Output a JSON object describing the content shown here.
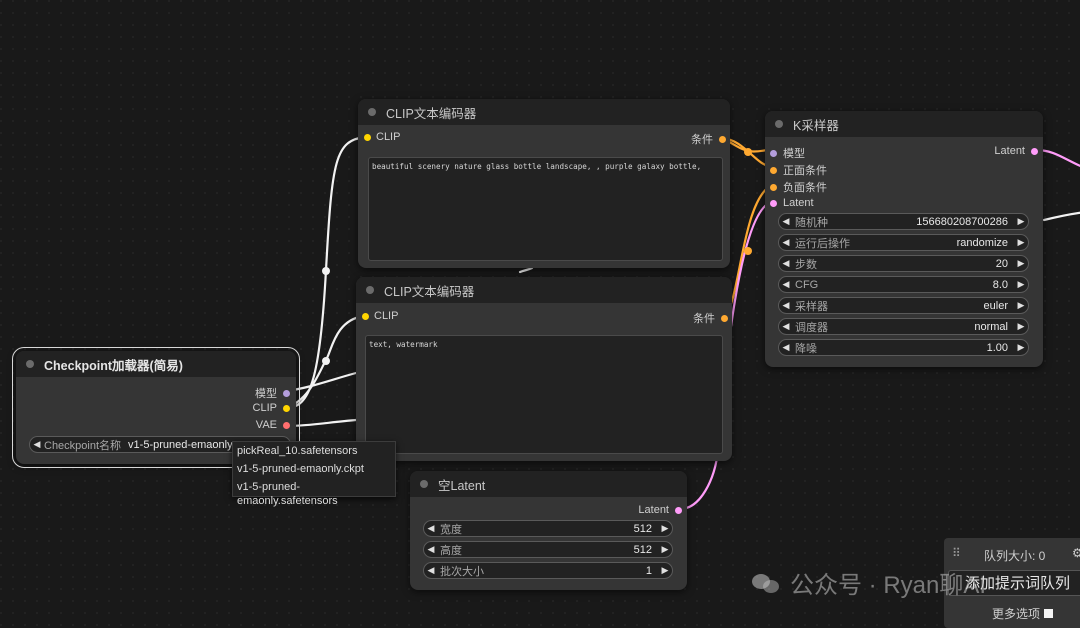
{
  "colors": {
    "clip": "#ffd500",
    "conditioning": "#ffa931",
    "model": "#b39ddb",
    "latent": "#ff9cf9",
    "vae": "#ff6e6e",
    "wire_white": "#f2f2f2"
  },
  "clip_text_encode_1": {
    "title": "CLIP文本编码器",
    "input_clip": "CLIP",
    "output_conditioning": "条件",
    "text": "beautiful scenery nature glass bottle landscape, , purple galaxy bottle,"
  },
  "clip_text_encode_2": {
    "title": "CLIP文本编码器",
    "input_clip": "CLIP",
    "output_conditioning": "条件",
    "text": "text, watermark"
  },
  "checkpoint_loader": {
    "title": "Checkpoint加载器(简易)",
    "out_model": "模型",
    "out_clip": "CLIP",
    "out_vae": "VAE",
    "widget_label": "Checkpoint名称",
    "widget_value": "v1-5-pruned-emaonly.c",
    "dropdown_options": [
      "pickReal_10.safetensors",
      "v1-5-pruned-emaonly.ckpt",
      "v1-5-pruned-emaonly.safetensors"
    ]
  },
  "empty_latent": {
    "title": "空Latent",
    "output": "Latent",
    "widgets": [
      {
        "label": "宽度",
        "value": "512"
      },
      {
        "label": "高度",
        "value": "512"
      },
      {
        "label": "批次大小",
        "value": "1"
      }
    ]
  },
  "ksampler": {
    "title": "K采样器",
    "in_model": "模型",
    "in_positive": "正面条件",
    "in_negative": "负面条件",
    "in_latent": "Latent",
    "output": "Latent",
    "widgets": [
      {
        "label": "随机种",
        "value": "156680208700286"
      },
      {
        "label": "运行后操作",
        "value": "randomize"
      },
      {
        "label": "步数",
        "value": "20"
      },
      {
        "label": "CFG",
        "value": "8.0"
      },
      {
        "label": "采样器",
        "value": "euler"
      },
      {
        "label": "调度器",
        "value": "normal"
      },
      {
        "label": "降噪",
        "value": "1.00"
      }
    ]
  },
  "queue_panel": {
    "queue_size": "队列大小: 0",
    "add_prompt": "添加提示词队列",
    "more_options": "更多选项"
  },
  "watermark": {
    "text": "公众号 · Ryan聊AI"
  }
}
